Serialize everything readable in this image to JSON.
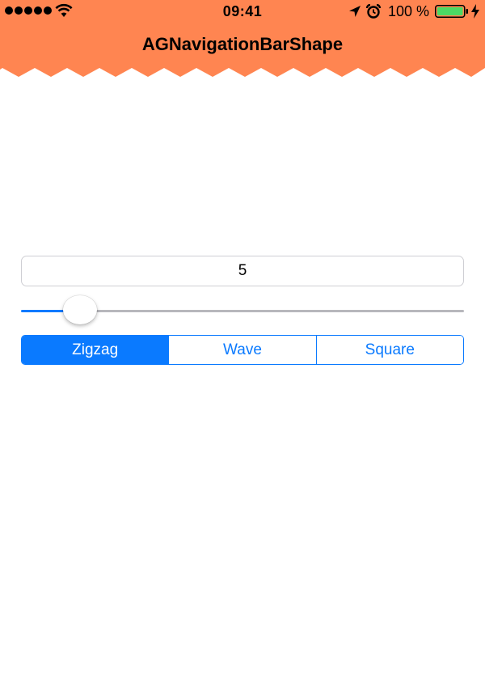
{
  "status_bar": {
    "time": "09:41",
    "battery_percent": "100 %",
    "signal_bars": 5,
    "battery_level": 1.0,
    "icons": [
      "signal-dots",
      "wifi-icon",
      "location-icon",
      "alarm-icon",
      "battery-icon",
      "charging-bolt-icon"
    ]
  },
  "nav_bar": {
    "title": "AGNavigationBarShape",
    "color": "#ff8551",
    "shape": "zigzag"
  },
  "value_field": {
    "value": "5"
  },
  "slider": {
    "value": 5,
    "fraction": 0.09,
    "min_track_color": "#0a7aff",
    "max_track_color": "#b7b7bc"
  },
  "segmented_control": {
    "segments": [
      "Zigzag",
      "Wave",
      "Square"
    ],
    "selected": "Zigzag",
    "accent": "#0a7aff"
  }
}
